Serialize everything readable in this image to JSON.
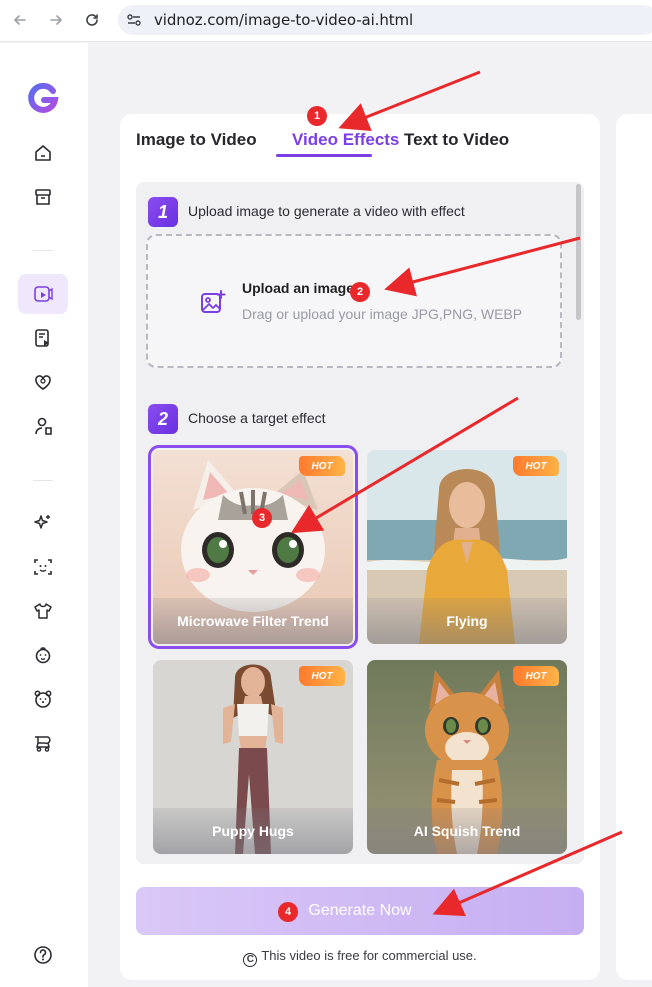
{
  "browser": {
    "url": "vidnoz.com/image-to-video-ai.html",
    "back_icon": "arrow-left-icon",
    "forward_icon": "arrow-right-icon",
    "reload_icon": "reload-icon"
  },
  "sidebar": {
    "items": [
      {
        "icon": "home-icon"
      },
      {
        "icon": "archive-icon"
      },
      {
        "icon": "image-video-icon",
        "active": true
      },
      {
        "icon": "script-video-icon"
      },
      {
        "icon": "heart-shield-icon"
      },
      {
        "icon": "avatar-icon"
      },
      {
        "icon": "sparkle-icon"
      },
      {
        "icon": "face-scan-icon"
      },
      {
        "icon": "tshirt-icon"
      },
      {
        "icon": "baby-icon"
      },
      {
        "icon": "bear-icon"
      },
      {
        "icon": "stroller-icon"
      },
      {
        "icon": "help-icon"
      }
    ]
  },
  "tabs": [
    {
      "label": "Image to Video"
    },
    {
      "label": "Video Effects",
      "active": true
    },
    {
      "label": "Text to Video"
    }
  ],
  "step1": {
    "number": "1",
    "label": "Upload image to generate a video with effect"
  },
  "upload": {
    "title": "Upload an image",
    "subtitle": "Drag or upload your image JPG,PNG, WEBP"
  },
  "step2": {
    "number": "2",
    "label": "Choose a target effect"
  },
  "effects": [
    {
      "label": "Microwave Filter Trend",
      "badge": "HOT",
      "selected": true
    },
    {
      "label": "Flying",
      "badge": "HOT"
    },
    {
      "label": "Puppy Hugs",
      "badge": "HOT"
    },
    {
      "label": "AI Squish Trend",
      "badge": "HOT"
    }
  ],
  "generate_button": "Generate Now",
  "free_note": "This video is free for commercial use.",
  "copyright_symbol": "C",
  "annotations": [
    "1",
    "2",
    "3",
    "4"
  ],
  "colors": {
    "accent": "#7b3fe4",
    "annotation": "#e8282a",
    "hot": "#ff8a3a"
  }
}
